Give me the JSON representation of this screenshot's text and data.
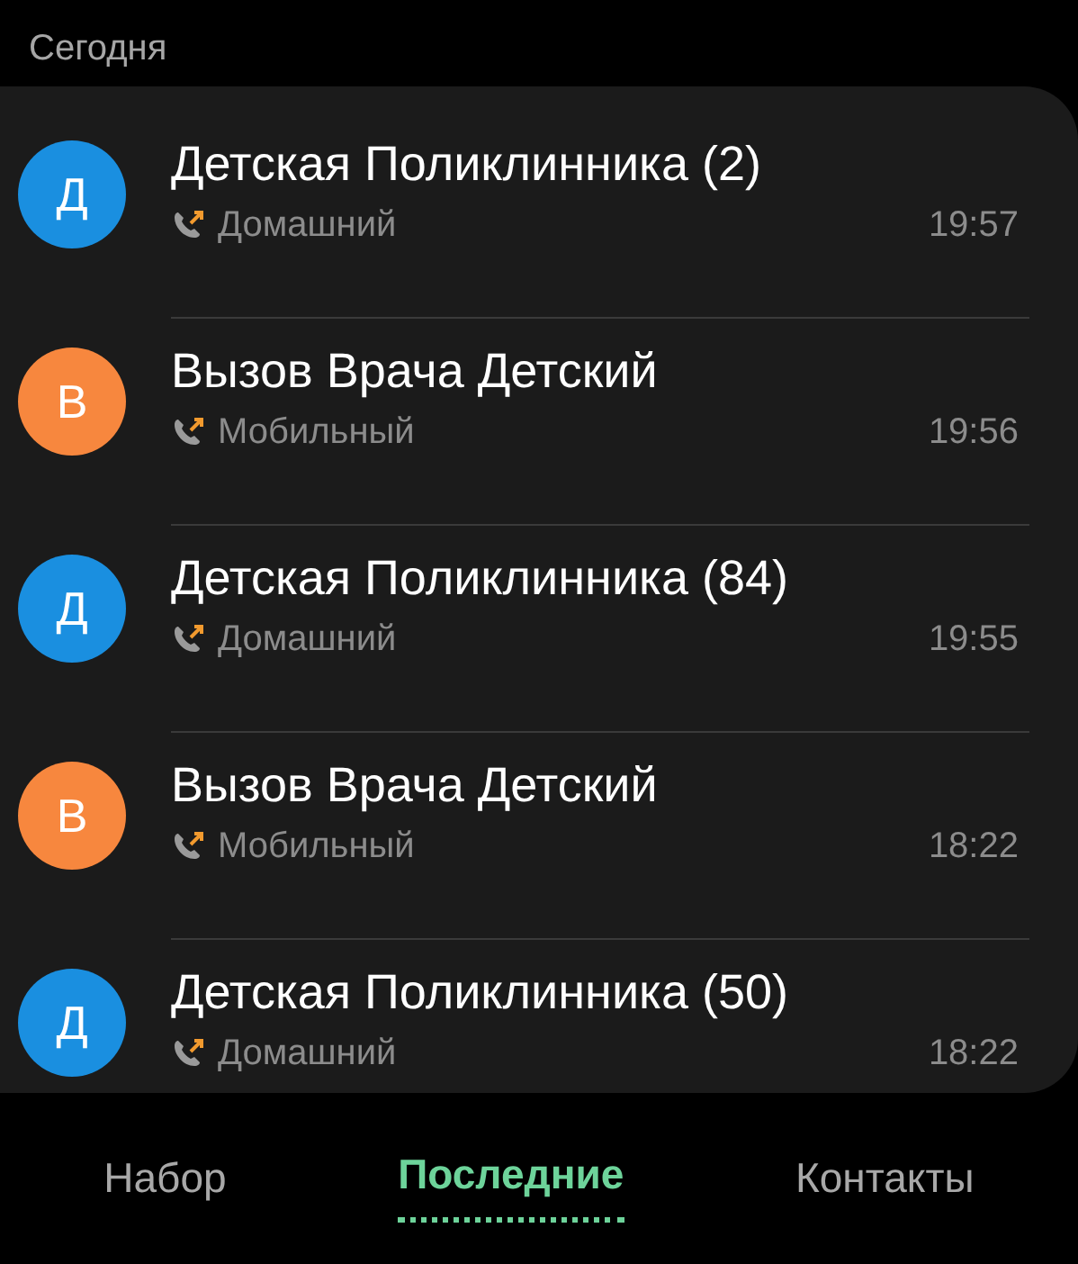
{
  "section_title": "Сегодня",
  "calls": [
    {
      "initial": "Д",
      "color": "#1a8fe0",
      "name": "Детская Поликлинника (2)",
      "number_type": "Домашний",
      "time": "19:57"
    },
    {
      "initial": "В",
      "color": "#f7873e",
      "name": "Вызов Врача Детский",
      "number_type": "Мобильный",
      "time": "19:56"
    },
    {
      "initial": "Д",
      "color": "#1a8fe0",
      "name": "Детская Поликлинника (84)",
      "number_type": "Домашний",
      "time": "19:55"
    },
    {
      "initial": "В",
      "color": "#f7873e",
      "name": "Вызов Врача Детский",
      "number_type": "Мобильный",
      "time": "18:22"
    },
    {
      "initial": "Д",
      "color": "#1a8fe0",
      "name": "Детская Поликлинника (50)",
      "number_type": "Домашний",
      "time": "18:22"
    }
  ],
  "tabs": [
    {
      "label": "Набор",
      "selected": false
    },
    {
      "label": "Последние",
      "selected": true
    },
    {
      "label": "Контакты",
      "selected": false
    }
  ]
}
